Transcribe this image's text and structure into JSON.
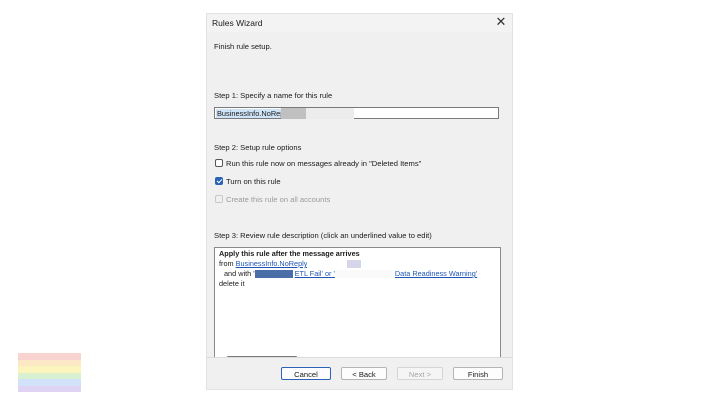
{
  "window": {
    "title": "Rules Wizard"
  },
  "header": {
    "text": "Finish rule setup."
  },
  "step1": {
    "label": "Step 1: Specify a name for this rule",
    "name_value": "BusinessInfo.NoRepl"
  },
  "step2": {
    "label": "Step 2: Setup rule options",
    "options": [
      {
        "label": "Run this rule now on messages already in \"Deleted Items\"",
        "checked": false,
        "disabled": false
      },
      {
        "label": "Turn on this rule",
        "checked": true,
        "disabled": false
      },
      {
        "label": "Create this rule on all accounts",
        "checked": false,
        "disabled": true
      }
    ]
  },
  "step3": {
    "label": "Step 3: Review rule description (click an underlined value to edit)",
    "line1": "Apply this rule after the message arrives",
    "line2_prefix": "from ",
    "line2_link": "BusinessInfo.NoReply",
    "line3_prefix": "and with '",
    "line3_link1": "ETL Fail' or '",
    "line3_link2": "Data Readiness Warning'",
    "line4": "delete it"
  },
  "buttons": {
    "cancel": "Cancel",
    "back": "< Back",
    "next": "Next >",
    "finish": "Finish"
  },
  "colors": {
    "accent": "#2a63b5",
    "link": "#1f56b5",
    "rainbow": [
      "#f8d3d0",
      "#fce8c4",
      "#fbf4bd",
      "#d9f1d1",
      "#d2e2fa",
      "#e0d4f5"
    ]
  }
}
